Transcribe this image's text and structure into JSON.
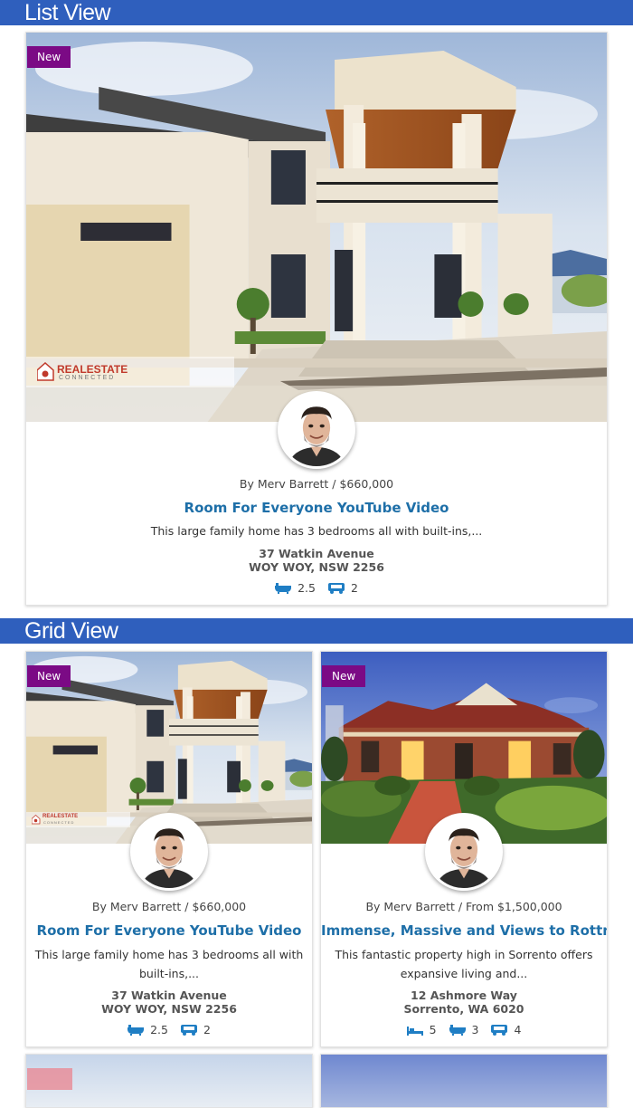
{
  "sections": {
    "list_title": "List View",
    "grid_title": "Grid View"
  },
  "colors": {
    "bar": "#2f5fbd",
    "badge": "#7b0a85",
    "title": "#1e6fa8",
    "feature_icon": "#1f7ec4"
  },
  "icons": {
    "bath": "bath-icon",
    "bed": "bed-icon",
    "car": "car-icon"
  },
  "list_card": {
    "badge": "New",
    "logo_brand": "REALESTATE",
    "logo_sub": "CONNECTED",
    "meta": "By Merv Barrett / $660,000",
    "title": "Room For Everyone YouTube Video",
    "desc": "This large family home has 3 bedrooms all with built-ins,...",
    "street": "37 Watkin Avenue",
    "suburb": "WOY WOY, NSW 2256",
    "baths": "2.5",
    "cars": "2"
  },
  "grid_cards": [
    {
      "badge": "New",
      "logo_brand": "REALESTATE",
      "logo_sub": "CONNECTED",
      "meta": "By Merv Barrett / $660,000",
      "title": "Room For Everyone YouTube Video",
      "desc": "This large family home has 3 bedrooms all with built-ins,...",
      "street": "37 Watkin Avenue",
      "suburb": "WOY WOY, NSW 2256",
      "baths": "2.5",
      "cars": "2"
    },
    {
      "badge": "New",
      "meta": "By Merv Barrett / From $1,500,000",
      "title": "Immense, Massive and Views to Rottnest",
      "desc": "This fantastic property high in Sorrento offers expansive living and...",
      "street": "12 Ashmore Way",
      "suburb": "Sorrento, WA 6020",
      "beds": "5",
      "baths": "3",
      "cars": "4"
    }
  ]
}
